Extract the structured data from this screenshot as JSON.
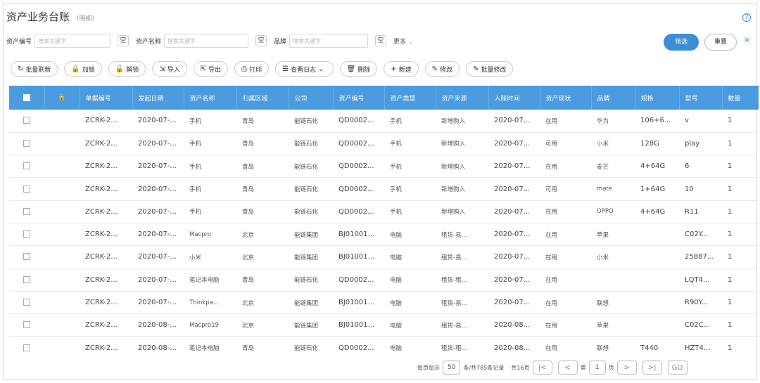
{
  "header": {
    "title": "资产业务台账",
    "subtitle": "(明细)"
  },
  "filters": [
    {
      "label": "资产编号",
      "placeholder": "搜索关键字",
      "empty_label": "空"
    },
    {
      "label": "资产名称",
      "placeholder": "搜索关键字",
      "empty_label": "空"
    },
    {
      "label": "品牌",
      "placeholder": "搜索关键字",
      "empty_label": "空"
    }
  ],
  "more_label": "更多",
  "actions": {
    "query": "筛选",
    "reset": "重置"
  },
  "toolbar": [
    {
      "icon": "↻",
      "label": "批量刷新"
    },
    {
      "icon": "🔒",
      "label": "加锁"
    },
    {
      "icon": "🔓",
      "label": "解锁"
    },
    {
      "icon": "⇲",
      "label": "导入"
    },
    {
      "icon": "⇱",
      "label": "导出"
    },
    {
      "icon": "⎙",
      "label": "打印"
    },
    {
      "icon": "☰",
      "label": "查看日志",
      "dropdown": "⌄"
    },
    {
      "icon": "🗑",
      "label": "删除"
    },
    {
      "icon": "+",
      "label": "新建"
    },
    {
      "icon": "✎",
      "label": "修改"
    },
    {
      "icon": "✎",
      "label": "批量修改"
    }
  ],
  "table": {
    "columns": [
      "单据编号",
      "发起日期",
      "资产名称",
      "归属区域",
      "公司",
      "资产编号",
      "资产类型",
      "资产来源",
      "入账时间",
      "资产现状",
      "品牌",
      "规格",
      "型号",
      "数量"
    ],
    "rows": [
      [
        "ZCRK-2...",
        "2020-07-...",
        "手机",
        "青岛",
        "能链石化",
        "QD0002...",
        "手机",
        "新增购入",
        "2020-07...",
        "在用",
        "华为",
        "106+6...",
        "v",
        "1"
      ],
      [
        "ZCRK-2...",
        "2020-07-...",
        "手机",
        "青岛",
        "能链石化",
        "QD0002...",
        "手机",
        "新增购入",
        "2020-07...",
        "可用",
        "小米",
        "128G",
        "play",
        "1"
      ],
      [
        "ZCRK-2...",
        "2020-07-...",
        "手机",
        "青岛",
        "能链石化",
        "QD0002...",
        "手机",
        "新增购入",
        "2020-07...",
        "在用",
        "麦芒",
        "4+64G",
        "6",
        "1"
      ],
      [
        "ZCRK-2...",
        "2020-07-...",
        "手机",
        "青岛",
        "能链石化",
        "QD0002...",
        "手机",
        "新增购入",
        "2020-07...",
        "可用",
        "mate",
        "1+64G",
        "10",
        "1"
      ],
      [
        "ZCRK-2...",
        "2020-07-...",
        "手机",
        "青岛",
        "能链石化",
        "QD0002...",
        "手机",
        "新增购入",
        "2020-07...",
        "在用",
        "OPPO",
        "4+64G",
        "R11",
        "1"
      ],
      [
        "ZCRK-2...",
        "2020-07-...",
        "Macpro",
        "北京",
        "能链集团",
        "BJ01001...",
        "电脑",
        "租赁-易...",
        "2020-07...",
        "在用",
        "苹果",
        "",
        "C02Y...",
        "1"
      ],
      [
        "ZCRK-2...",
        "2020-07-...",
        "小米",
        "北京",
        "能链集团",
        "BJ01001...",
        "电脑",
        "租赁-易...",
        "2020-07...",
        "在用",
        "小米",
        "",
        "25887...",
        "1"
      ],
      [
        "ZCRK-2...",
        "2020-07-...",
        "笔记本电脑",
        "青岛",
        "能链石化",
        "QD0002...",
        "电脑",
        "租赁-租...",
        "2020-07...",
        "在用",
        "",
        "",
        "LQT4...",
        "1"
      ],
      [
        "ZCRK-2...",
        "2020-07-...",
        "Thinkpa...",
        "北京",
        "能链集团",
        "BJ01001...",
        "电脑",
        "租赁-易...",
        "2020-07...",
        "在用",
        "联想",
        "",
        "R90Y...",
        "1"
      ],
      [
        "ZCRK-2...",
        "2020-08-...",
        "Macpro19",
        "北京",
        "能链集团",
        "BJ01001...",
        "电脑",
        "租赁-易...",
        "2020-08...",
        "在用",
        "苹果",
        "",
        "C02C...",
        "1"
      ],
      [
        "ZCRK-2...",
        "2020-08-...",
        "笔记本电脑",
        "青岛",
        "能链石化",
        "QD0002...",
        "电脑",
        "租赁-租...",
        "2020-08...",
        "在用",
        "联想",
        "T440",
        "HZT4...",
        "1"
      ]
    ]
  },
  "pagination": {
    "per_page_label": "每页显示",
    "per_page": "50",
    "total_label": "条/共785条记录",
    "pages_label": "共16页",
    "first": "|<",
    "prev": "<",
    "page_prefix": "第",
    "current_page": "1",
    "page_suffix": "页",
    "next": ">",
    "last": ">|",
    "go": "GO"
  },
  "colors": {
    "accent": "#3b8ed6",
    "header_bg": "#4a9be0"
  }
}
